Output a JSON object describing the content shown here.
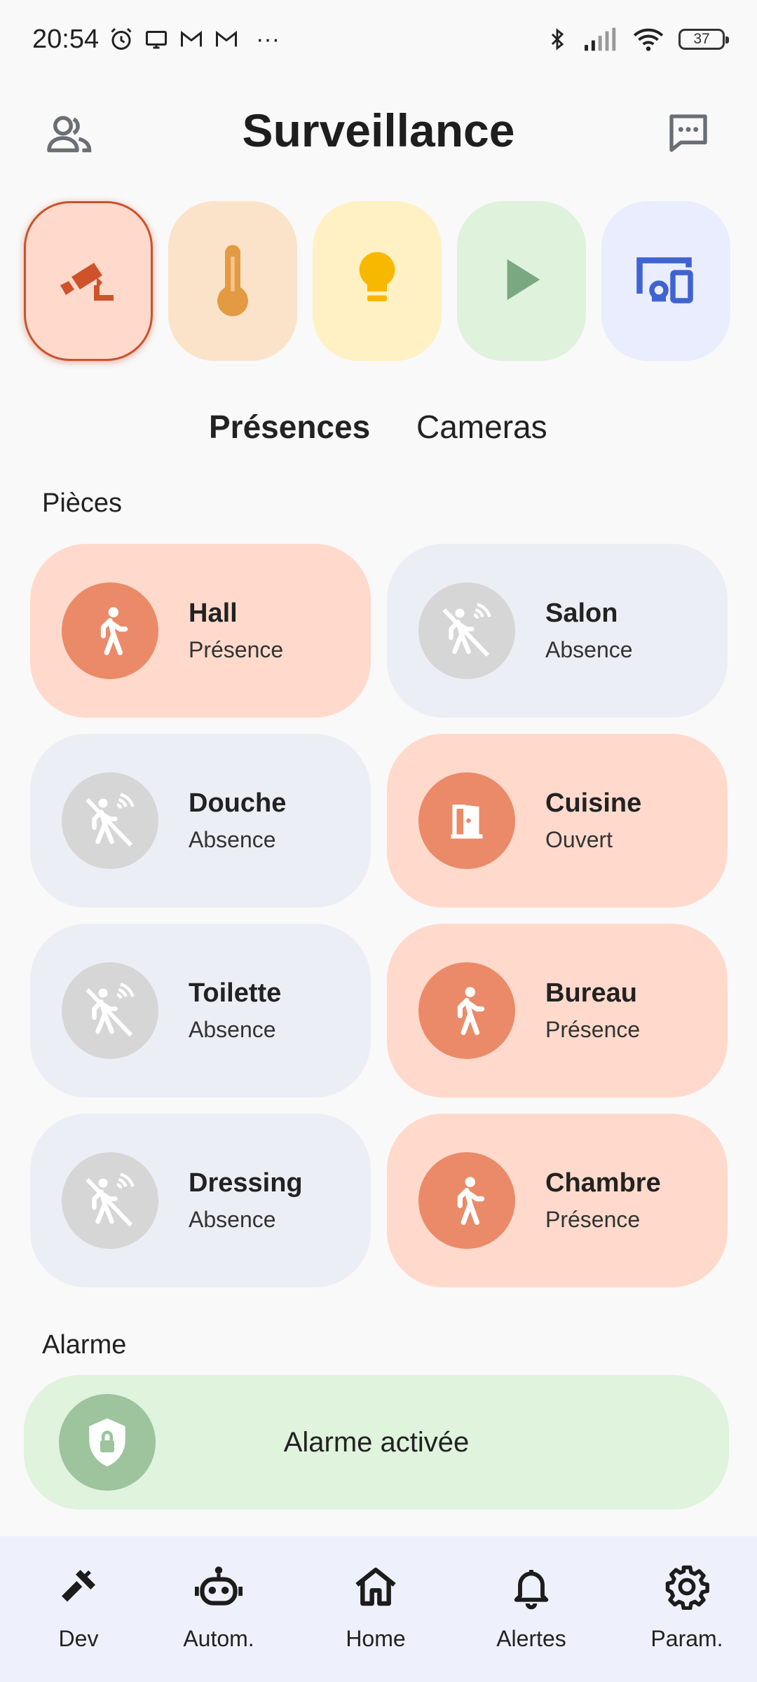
{
  "status_bar": {
    "time": "20:54",
    "more": "···",
    "battery": "37",
    "icons": [
      "alarm-icon",
      "screen-icon",
      "gmail-icon",
      "gmail-icon",
      "bluetooth-icon",
      "signal-icon",
      "wifi-icon",
      "battery-icon"
    ]
  },
  "header": {
    "title": "Surveillance",
    "left_icon": "users-icon",
    "right_icon": "chat-icon"
  },
  "categories": [
    {
      "name": "security-camera",
      "icon": "cctv-icon",
      "bg": "#ffdacc",
      "fg": "#d0522a",
      "active": true
    },
    {
      "name": "temperature",
      "icon": "thermometer-icon",
      "bg": "#fbe3c9",
      "fg": "#e49a42",
      "active": false
    },
    {
      "name": "lighting",
      "icon": "lightbulb-icon",
      "bg": "#fff1c4",
      "fg": "#f9b800",
      "active": false
    },
    {
      "name": "media",
      "icon": "play-icon",
      "bg": "#def2dc",
      "fg": "#7aa880",
      "active": false
    },
    {
      "name": "devices",
      "icon": "devices-icon",
      "bg": "#e9edfd",
      "fg": "#3f63d0",
      "active": false
    }
  ],
  "tabs": [
    {
      "label": "Présences",
      "active": true
    },
    {
      "label": "Cameras",
      "active": false
    }
  ],
  "rooms_section": {
    "title": "Pièces"
  },
  "rooms": [
    {
      "name": "Hall",
      "status": "Présence",
      "state": "on",
      "icon": "walking-person-icon"
    },
    {
      "name": "Salon",
      "status": "Absence",
      "state": "off",
      "icon": "motion-off-icon"
    },
    {
      "name": "Douche",
      "status": "Absence",
      "state": "off",
      "icon": "motion-off-icon"
    },
    {
      "name": "Cuisine",
      "status": "Ouvert",
      "state": "on",
      "icon": "door-open-icon"
    },
    {
      "name": "Toilette",
      "status": "Absence",
      "state": "off",
      "icon": "motion-off-icon"
    },
    {
      "name": "Bureau",
      "status": "Présence",
      "state": "on",
      "icon": "walking-person-icon"
    },
    {
      "name": "Dressing",
      "status": "Absence",
      "state": "off",
      "icon": "motion-off-icon"
    },
    {
      "name": "Chambre",
      "status": "Présence",
      "state": "on",
      "icon": "walking-person-icon"
    }
  ],
  "alarm_section": {
    "title": "Alarme"
  },
  "alarm": {
    "label": "Alarme activée",
    "icon": "shield-lock-icon"
  },
  "nav": [
    {
      "label": "Dev",
      "icon": "hammer-icon"
    },
    {
      "label": "Autom.",
      "icon": "robot-icon"
    },
    {
      "label": "Home",
      "icon": "home-icon"
    },
    {
      "label": "Alertes",
      "icon": "bell-icon"
    },
    {
      "label": "Param.",
      "icon": "gear-icon"
    }
  ],
  "colors": {
    "room_on_bg": "#ffdacc",
    "room_on_icon": "#eb8a68",
    "room_off_bg": "#eceef5",
    "room_off_icon": "#d6d6d6",
    "alarm_bg": "#dff3dd",
    "alarm_icon": "#9dc49d",
    "nav_bg": "#eef1fb"
  }
}
